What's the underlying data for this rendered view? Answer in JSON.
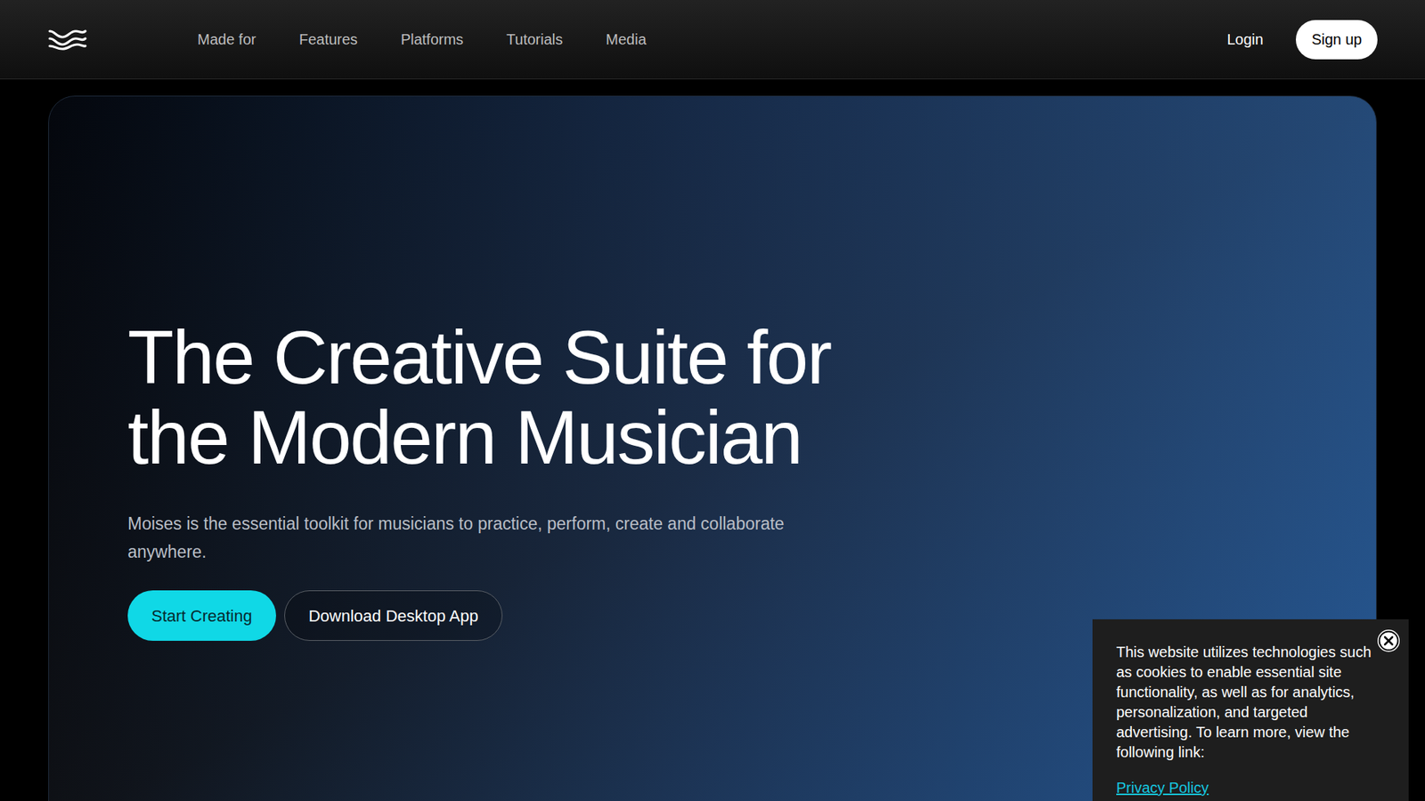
{
  "nav": {
    "links": [
      {
        "label": "Made for"
      },
      {
        "label": "Features"
      },
      {
        "label": "Platforms"
      },
      {
        "label": "Tutorials"
      },
      {
        "label": "Media"
      }
    ],
    "login": "Login",
    "signup": "Sign up"
  },
  "hero": {
    "title_lines": [
      "The Creative Suite for",
      "the Modern Musician"
    ],
    "subtitle": "Moises is the essential toolkit for musicians to practice, perform, create and collaborate anywhere.",
    "buttons": [
      {
        "label": "Start Creating",
        "kind": "primary"
      },
      {
        "label": "Download Desktop App",
        "kind": "secondary"
      }
    ]
  },
  "cookie_banner": {
    "text": "This website utilizes technologies such as cookies to enable essential site functionality, as well as for analytics, personalization, and targeted advertising. To learn more, view the following link:",
    "link": "Privacy Policy"
  }
}
